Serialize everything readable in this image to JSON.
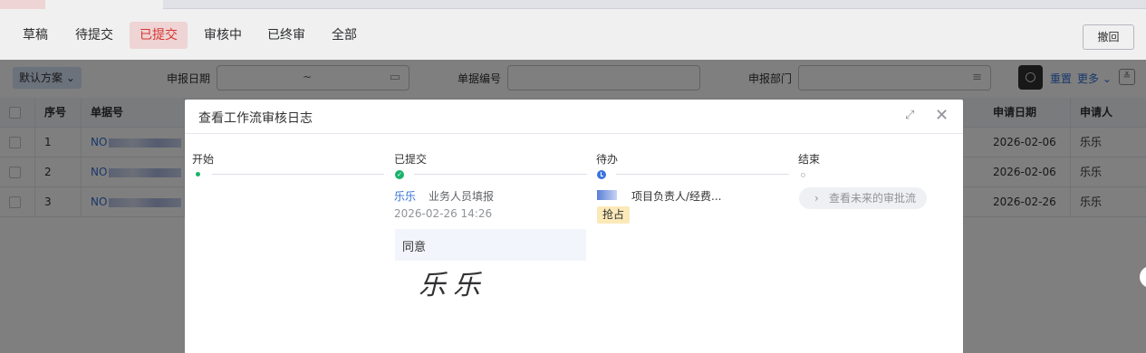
{
  "status_tabs": [
    "草稿",
    "待提交",
    "已提交",
    "审核中",
    "已终审",
    "全部"
  ],
  "active_tab": "已提交",
  "revoke_label": "撤回",
  "filter": {
    "scheme_label": "默认方案",
    "date_label": "申报日期",
    "date_separator": "~",
    "docno_label": "单据编号",
    "dept_label": "申报部门",
    "reset_label": "重置",
    "more_label": "更多"
  },
  "table": {
    "columns": [
      "序号",
      "单据号",
      "申请日期",
      "申请人"
    ],
    "rows": [
      {
        "seq": "1",
        "doc_no": "NO",
        "date": "2026-02-06",
        "applicant": "乐乐"
      },
      {
        "seq": "2",
        "doc_no": "NO",
        "date": "2026-02-06",
        "applicant": "乐乐"
      },
      {
        "seq": "3",
        "doc_no": "NO",
        "date": "2026-02-26",
        "applicant": "乐乐"
      }
    ]
  },
  "dialog": {
    "title": "查看工作流审核日志",
    "steps": [
      {
        "title": "开始"
      },
      {
        "title": "已提交",
        "approver": "乐乐",
        "role": "业务人员填报",
        "time": "2026-02-26 14:26",
        "opinion": "同意",
        "signature": "乐乐"
      },
      {
        "title": "待办",
        "role": "项目负责人/经费...",
        "badge": "抢占"
      },
      {
        "title": "结束",
        "future_label": "查看未来的审批流"
      }
    ]
  },
  "colors": {
    "accent": "#2f6fd6",
    "active_tab_bg": "#fde2e2",
    "active_tab_text": "#e53935",
    "done": "#19b36b",
    "pending": "#3b73e0",
    "badge_bg": "#fce9b8"
  }
}
